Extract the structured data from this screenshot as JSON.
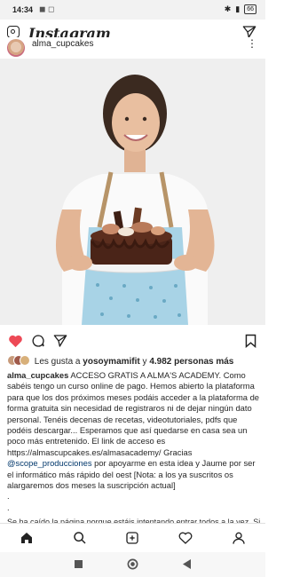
{
  "status": {
    "time": "14:34",
    "battery": "66"
  },
  "app": {
    "title": "Instagram"
  },
  "post": {
    "username": "alma_cupcakes",
    "liked_by_prefix": "Les gusta a",
    "liked_by_user": "yosoymamifit",
    "liked_by_suffix": "y",
    "likes_count": "4.982 personas más",
    "caption_user": "alma_cupcakes",
    "caption_text": " ACCESO GRATIS A ALMA'S ACADEMY. Como sabéis tengo un curso online de pago. Hemos abierto la plataforma para que los dos próximos meses podáis acceder a la plataforma de forma gratuita sin necesidad de registraros ni de dejar ningún dato personal. Tenéis decenas de recetas, videotutoriales, pdfs que podéis descargar... Esperamos que así quedarse en casa sea un poco más entretenido. El link de acceso es https://almascupcakes.es/almasacademy/ Gracias ",
    "caption_mention": "@scope_producciones",
    "caption_text2": " por apoyarme en esta idea y Jaume por ser el informático más rápido del oest [Nota: a los ya suscritos os alargaremos dos meses la suscripción actual]",
    "dots": [
      ".",
      ".",
      "."
    ],
    "cut_line": "Se ha caído la página porque estáis intentando entrar todos a la vez. Si"
  },
  "nav": {
    "items": [
      "home",
      "search",
      "add",
      "activity",
      "profile"
    ]
  },
  "icons": {
    "heart": "heart-icon",
    "comment": "comment-icon",
    "share": "send-icon",
    "bookmark": "bookmark-icon"
  },
  "colors": {
    "like_red": "#ed4956",
    "mention": "#00376b"
  }
}
